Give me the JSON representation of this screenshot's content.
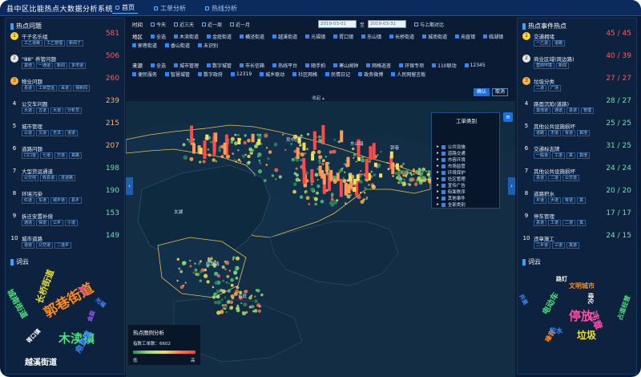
{
  "header": {
    "title": "县中区比能热点大数据分析系统",
    "nav": [
      {
        "label": "首页",
        "active": true
      },
      {
        "label": "工单分析",
        "active": false
      },
      {
        "label": "热线分析",
        "active": false
      }
    ]
  },
  "left_panel": {
    "title": "热点问题",
    "items": [
      {
        "rank": "1",
        "name": "干子名乐组",
        "count": "581",
        "tags": [
          "工乙道路",
          "工乙管理",
          "新闻了"
        ]
      },
      {
        "rank": "2",
        "name": "\"ⅢⅢ\" 养管问题",
        "count": "506",
        "tags": [
          "其他",
          "一通道",
          "新闻",
          "多市道"
        ]
      },
      {
        "rank": "3",
        "name": "物业问题",
        "count": "260",
        "tags": [
          "县道",
          "工目营运",
          "采道",
          "保新闻"
        ]
      },
      {
        "rank": "4",
        "name": "公交车问题",
        "count": "239",
        "tags": [
          "大道",
          "五道",
          "大道",
          "分析员"
        ]
      },
      {
        "rank": "5",
        "name": "城市管理",
        "count": "215",
        "tags": [
          "公道",
          "文道",
          "无法",
          "道道"
        ]
      },
      {
        "rank": "6",
        "name": "道路问题",
        "count": "207",
        "tags": [
          "口口道",
          "七道",
          "万道",
          "其路"
        ]
      },
      {
        "rank": "7",
        "name": "大型货运通道",
        "count": "198",
        "tags": [
          "公交线",
          "收县道",
          "进道路"
        ]
      },
      {
        "rank": "8",
        "name": "环境污染",
        "count": "190",
        "tags": [
          "红道",
          "东道",
          "城乡道",
          "县乡"
        ]
      },
      {
        "rank": "9",
        "name": "拆迁安置补偿",
        "count": "153",
        "tags": [
          "通道",
          "保道",
          "公乡",
          "小道"
        ]
      },
      {
        "rank": "10",
        "name": "城市道路",
        "count": "149",
        "tags": [
          "道道",
          "公交道",
          "二道乡"
        ]
      }
    ],
    "wordcloud_title": "词云",
    "words": [
      {
        "text": "郭巷街道",
        "color": "#ff8a1f"
      },
      {
        "text": "木渎镇",
        "color": "#4be07c"
      },
      {
        "text": "越溪街道",
        "color": "#ffffff"
      },
      {
        "text": "城南街道",
        "color": "#4be07c"
      },
      {
        "text": "甪直镇",
        "color": "#3a8dff"
      },
      {
        "text": "长桥街道",
        "color": "#e8e030"
      },
      {
        "text": "横泾",
        "color": "#ff4da6"
      },
      {
        "text": "胥口镇",
        "color": "#ffffff"
      },
      {
        "text": "金庭",
        "color": "#9a5cff"
      },
      {
        "text": "光福",
        "color": "#3a8dff"
      }
    ]
  },
  "right_panel": {
    "title": "热点事件热点",
    "items": [
      {
        "rank": "1",
        "name": "交通拥堵",
        "count": "45 / 45",
        "tags": [
          "一乙道",
          "道路"
        ]
      },
      {
        "rank": "2",
        "name": "商业区域(周边路)",
        "count": "40 / 39",
        "tags": [
          "营商环境",
          "新闻"
        ]
      },
      {
        "rank": "3",
        "name": "垃圾分类",
        "count": "27 / 27",
        "tags": [
          "二道",
          "广场"
        ]
      },
      {
        "rank": "4",
        "name": "路面沉陷(道路)",
        "count": "28 / 27",
        "tags": [
          "其他道",
          "通道",
          "县道",
          "管理"
        ]
      },
      {
        "rank": "5",
        "name": "其他公共设施损坏",
        "count": "25 / 25",
        "tags": [
          "道路",
          "无道",
          "有道",
          "其他"
        ]
      },
      {
        "rank": "6",
        "name": "交通标志牌",
        "count": "31 / 25",
        "tags": [
          "一般道",
          "工道",
          "其",
          "其他"
        ]
      },
      {
        "rank": "7",
        "name": "其他公共设施损坏",
        "count": "24 / 24",
        "tags": [
          "县道",
          "二道",
          "公交道"
        ]
      },
      {
        "rank": "8",
        "name": "道路积水",
        "count": "20 / 20",
        "tags": [
          "乡道",
          "大道",
          "有道",
          "其"
        ]
      },
      {
        "rank": "9",
        "name": "停车管理",
        "count": "17 / 17",
        "tags": [
          "县道",
          "工道",
          "二道",
          "其"
        ]
      },
      {
        "rank": "10",
        "name": "违章施工",
        "count": "24 / 15",
        "tags": [
          "二乡道",
          "三道",
          "其道"
        ]
      }
    ],
    "wordcloud_title": "词云",
    "words": [
      {
        "text": "停放",
        "color": "#ff4da6"
      },
      {
        "text": "垃圾",
        "color": "#e8e030"
      },
      {
        "text": "电动车",
        "color": "#4be07c"
      },
      {
        "text": "违章",
        "color": "#ff4da6"
      },
      {
        "text": "路灯",
        "color": "#ffffff"
      },
      {
        "text": "井盖",
        "color": "#3a8dff"
      },
      {
        "text": "噪音",
        "color": "#ff8a1f"
      },
      {
        "text": "占道经营",
        "color": "#4be07c"
      },
      {
        "text": "文明城市",
        "color": "#ff8a1f"
      },
      {
        "text": "绿化",
        "color": "#ffffff"
      },
      {
        "text": "积水",
        "color": "#3a8dff"
      }
    ]
  },
  "filters": {
    "time_label": "时间",
    "time_options": [
      {
        "label": "今天",
        "checked": false
      },
      {
        "label": "近三天",
        "checked": false
      },
      {
        "label": "近一周",
        "checked": false
      },
      {
        "label": "近一月",
        "checked": false
      }
    ],
    "date_start": "2019-03-01",
    "date_end": "2019-03-31",
    "date_sep": "至",
    "compare_label": "与上期对比",
    "area_label": "地区",
    "area_all": "全选",
    "areas": [
      "木渎街道",
      "金庭街道",
      "横泾街道",
      "越溪街道",
      "光福镇",
      "胥口镇",
      "东山镇",
      "长桥街道",
      "城南街道",
      "甪直镇",
      "临湖镇",
      "郭巷街道",
      "香山街道",
      "未识别"
    ],
    "source_label": "来源",
    "source_all": "全选",
    "sources": [
      "城市管理",
      "数字城管",
      "市长信箱",
      "热线平台",
      "随手拍",
      "寒山闻钟",
      "网格巡查",
      "环保专项",
      "110联动",
      "12345",
      "便民服务",
      "智慧城管",
      "数字政府",
      "12319",
      "城乡联动",
      "社区网格",
      "民情日记",
      "政务微博",
      "人民网留言板"
    ],
    "confirm_label": "确认",
    "reset_label": "取消",
    "collapse_label": "收起 ▴"
  },
  "map": {
    "layers_title": "工单类别",
    "layers": [
      "公共设施",
      "道路交通",
      "市容环境",
      "市场监管",
      "环境保护",
      "社区管理",
      "宣传广告",
      "街面秩序",
      "其他事件",
      "全部类别"
    ],
    "legend_title": "热点图例分析",
    "legend_total_label": "指数工单数：",
    "legend_total": "6602",
    "legend_low": "低",
    "legend_high": "高",
    "places": [
      "太湖",
      "吴中区",
      "东山镇",
      "郭巷",
      "甪直",
      "临湖镇",
      "金庭"
    ]
  },
  "colors": {
    "header_bg": "#0b2a5e",
    "panel_bg": "#0d223f",
    "accent": "#3aa0ff",
    "count_hot": "#ff5a5a",
    "count_warm": "#ffb44d",
    "count_mid": "#6fe0a8"
  }
}
